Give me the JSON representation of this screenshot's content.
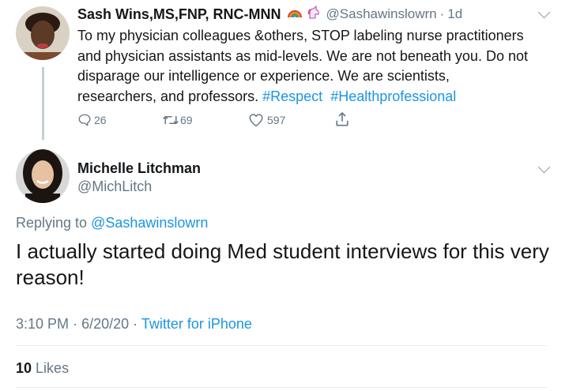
{
  "parent_tweet": {
    "display_name": "Sash Wins,MS,FNP, RNC-MNN",
    "emojis": "rainbow, unicorn",
    "handle": "@Sashawinslowrn",
    "separator": "·",
    "time": "1d",
    "text": "To my physician colleagues &others, STOP labeling nurse practitioners\nand physician assistants as mid-levels. We are not beneath you. Do not\ndisparage our intelligence or experience. We are scientists,\nresearchers, and professors.",
    "hashtags": [
      "#Respect",
      "#Healthprofessional"
    ],
    "actions": {
      "replies": "26",
      "retweets": "69",
      "likes": "597"
    }
  },
  "main_tweet": {
    "display_name": "Michelle Litchman",
    "handle": "@MichLitch",
    "replying_label": "Replying to",
    "replying_handle": "@Sashawinslowrn",
    "text": "I actually started doing Med student interviews for this very\nreason!",
    "time": "3:10 PM",
    "date": "6/20/20",
    "separator": "·",
    "source": "Twitter for iPhone",
    "likes_count": "10",
    "likes_label": "Likes"
  },
  "colors": {
    "link": "#1b95e0",
    "muted": "#657786",
    "divider": "#e6ecf0"
  },
  "icons": [
    "reply-icon",
    "retweet-icon",
    "like-icon",
    "share-icon",
    "chevron-down-icon"
  ]
}
